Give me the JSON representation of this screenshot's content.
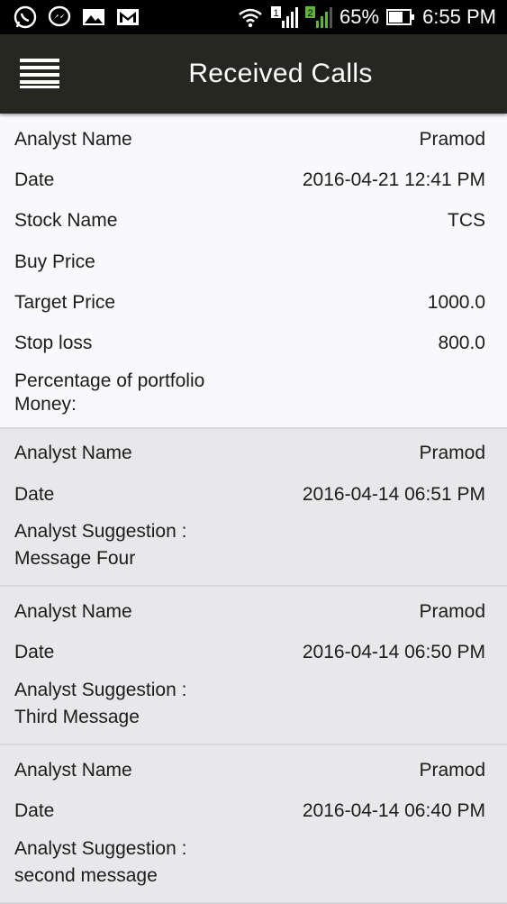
{
  "status_bar": {
    "battery": "65%",
    "time": "6:55 PM",
    "sim1": "1",
    "sim2": "2",
    "left_icons": [
      "whatsapp-icon",
      "messenger-icon",
      "gallery-icon",
      "gmail-icon"
    ]
  },
  "app_bar": {
    "title": "Received Calls"
  },
  "calls": [
    {
      "rows": [
        {
          "label": "Analyst Name",
          "value": "Pramod"
        },
        {
          "label": "Date",
          "value": "2016-04-21 12:41 PM"
        },
        {
          "label": "Stock Name",
          "value": "TCS"
        },
        {
          "label": "Buy Price",
          "value": ""
        },
        {
          "label": "Target Price",
          "value": "1000.0"
        },
        {
          "label": "Stop loss",
          "value": "800.0"
        }
      ],
      "portfolio_label_line1": "Percentage of portfolio",
      "portfolio_label_line2": "Money:"
    },
    {
      "analyst_label": "Analyst Name",
      "analyst": "Pramod",
      "date_label": "Date",
      "date": "2016-04-14 06:51 PM",
      "suggestion_label": "Analyst Suggestion :",
      "suggestion": "Message Four"
    },
    {
      "analyst_label": "Analyst Name",
      "analyst": "Pramod",
      "date_label": "Date",
      "date": "2016-04-14 06:50 PM",
      "suggestion_label": "Analyst Suggestion :",
      "suggestion": "Third Message"
    },
    {
      "analyst_label": "Analyst Name",
      "analyst": "Pramod",
      "date_label": "Date",
      "date": "2016-04-14 06:40 PM",
      "suggestion_label": "Analyst Suggestion :",
      "suggestion": "second message"
    }
  ]
}
